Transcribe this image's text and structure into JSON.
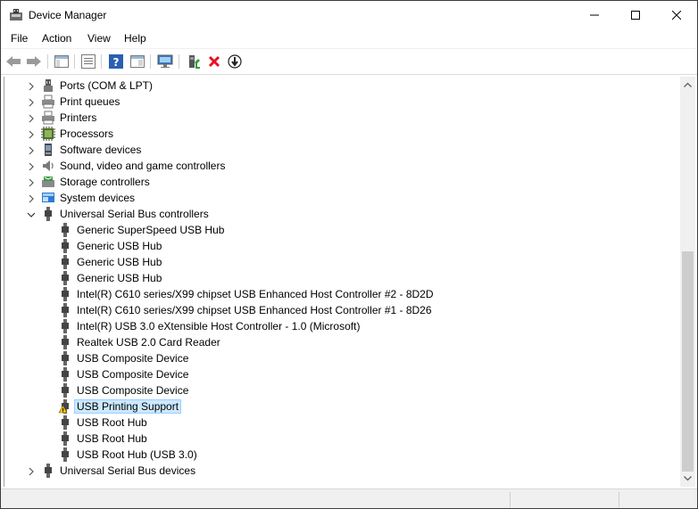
{
  "window": {
    "title": "Device Manager"
  },
  "menu": [
    "File",
    "Action",
    "View",
    "Help"
  ],
  "toolbar": {
    "buttons": [
      "back-icon",
      "forward-icon",
      "show-hide-tree-icon",
      "properties-icon",
      "help-icon",
      "view-icon",
      "scan-hardware-icon",
      "update-driver-icon",
      "uninstall-device-icon",
      "disable-device-icon"
    ]
  },
  "tree": {
    "categories_before": [
      {
        "label": "Ports (COM & LPT)",
        "icon": "port-icon"
      },
      {
        "label": "Print queues",
        "icon": "printer-icon"
      },
      {
        "label": "Printers",
        "icon": "printer-icon"
      },
      {
        "label": "Processors",
        "icon": "processor-icon"
      },
      {
        "label": "Software devices",
        "icon": "software-device-icon"
      },
      {
        "label": "Sound, video and game controllers",
        "icon": "speaker-icon"
      },
      {
        "label": "Storage controllers",
        "icon": "storage-icon"
      },
      {
        "label": "System devices",
        "icon": "system-icon"
      }
    ],
    "expanded": {
      "label": "Universal Serial Bus controllers",
      "children": [
        {
          "label": "Generic SuperSpeed USB Hub",
          "warning": false,
          "selected": false
        },
        {
          "label": "Generic USB Hub",
          "warning": false,
          "selected": false
        },
        {
          "label": "Generic USB Hub",
          "warning": false,
          "selected": false
        },
        {
          "label": "Generic USB Hub",
          "warning": false,
          "selected": false
        },
        {
          "label": "Intel(R) C610 series/X99 chipset USB Enhanced Host Controller #2 - 8D2D",
          "warning": false,
          "selected": false
        },
        {
          "label": "Intel(R) C610 series/X99 chipset USB Enhanced Host Controller #1 - 8D26",
          "warning": false,
          "selected": false
        },
        {
          "label": "Intel(R) USB 3.0 eXtensible Host Controller - 1.0 (Microsoft)",
          "warning": false,
          "selected": false
        },
        {
          "label": "Realtek USB 2.0 Card Reader",
          "warning": false,
          "selected": false
        },
        {
          "label": "USB Composite Device",
          "warning": false,
          "selected": false
        },
        {
          "label": "USB Composite Device",
          "warning": false,
          "selected": false
        },
        {
          "label": "USB Composite Device",
          "warning": false,
          "selected": false
        },
        {
          "label": "USB Printing Support",
          "warning": true,
          "selected": true
        },
        {
          "label": "USB Root Hub",
          "warning": false,
          "selected": false
        },
        {
          "label": "USB Root Hub",
          "warning": false,
          "selected": false
        },
        {
          "label": "USB Root Hub (USB 3.0)",
          "warning": false,
          "selected": false
        }
      ]
    },
    "categories_after": [
      {
        "label": "Universal Serial Bus devices",
        "icon": "usb-icon"
      }
    ]
  },
  "colors": {
    "selection": "#cce8ff",
    "selection_border": "#99d1ff",
    "uninstall_red": "#e81123",
    "warning_yellow": "#f2c811"
  }
}
